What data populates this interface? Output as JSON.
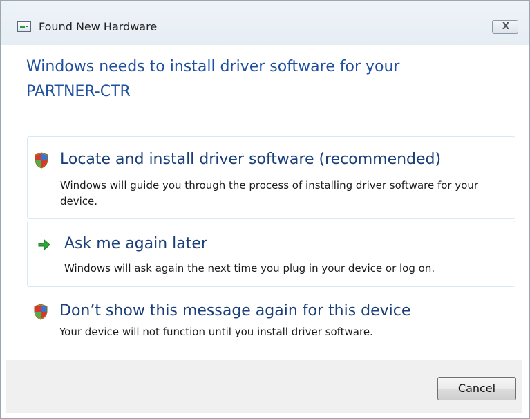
{
  "window": {
    "title": "Found New Hardware",
    "close_label": "X"
  },
  "headline": "Windows needs to install driver software for your PARTNER-CTR",
  "options": [
    {
      "icon": "shield-icon",
      "title": "Locate and install driver software (recommended)",
      "description": "Windows will guide you through the process of installing driver software for your device."
    },
    {
      "icon": "green-arrow-icon",
      "title": "Ask me again later",
      "description": "Windows will ask again the next time you plug in your device or log on."
    },
    {
      "icon": "shield-icon",
      "title": "Don’t show this message again for this device",
      "description": "Your device will not function until you install driver software."
    }
  ],
  "footer": {
    "cancel_label": "Cancel"
  },
  "colors": {
    "headline": "#1f4fa0",
    "option_title": "#1a3f7a",
    "option_border": "#d6e9f4",
    "footer_bg": "#f0f0f0"
  }
}
